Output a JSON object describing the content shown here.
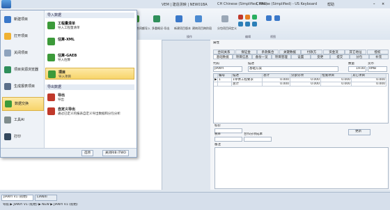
{
  "titlebar": {
    "app_title": "VEM | 建造测映 | NEW01BA",
    "ime1": "CH Chinese (Simplified, PRC)",
    "ime2": "Chinese (Simplified) - US Keyboard",
    "help": "帮助"
  },
  "ribbon": {
    "buttons": [
      "合同额导入",
      "多重概况-导出",
      "新建项目版本",
      "建筑项目跨阶段",
      "分包项目间定义"
    ],
    "groups": [
      "操作",
      "编辑",
      "视图"
    ]
  },
  "menu": {
    "left_items": [
      {
        "label": "新建项目"
      },
      {
        "label": "打开项目"
      },
      {
        "label": "关闭项目"
      },
      {
        "label": "项目资源浏览器"
      },
      {
        "label": "生成报表项目"
      },
      {
        "label": "数据交换"
      },
      {
        "label": "工具AI"
      },
      {
        "label": "打印"
      }
    ],
    "import_header": "导入数据",
    "import_items": [
      {
        "title": "工程量清单",
        "desc": "导入工程量清单"
      },
      {
        "title": "估算-XML",
        "desc": ""
      },
      {
        "title": "估算-GAEB",
        "desc": "导入估算"
      },
      {
        "title": "项目",
        "desc": "导入项目"
      }
    ],
    "export_header": "导出数据",
    "export_items": [
      {
        "title": "导出",
        "desc": "导出"
      },
      {
        "title": "自定义导出",
        "desc": "通过已定义的报表自定义导出数据和分包分析"
      }
    ],
    "footer": {
      "options": "选项",
      "exit": "关闭RIB iTWO"
    }
  },
  "rightpane": {
    "title": "属性",
    "tabs_row1": [
      "合同关系",
      "保证金",
      "条款集合",
      "关键数据",
      "付款方",
      "资金流",
      "其它地址",
      "授权"
    ],
    "tabs_row2": [
      "基础数据",
      "项目信息",
      "备份一览",
      "项目管理",
      "设置",
      "变更",
      "提交",
      "分包",
      "补充"
    ],
    "code_label": "代码",
    "code_value": "JIANYI",
    "desc_label": "描述",
    "desc_value": "基础方案",
    "currency_label": "货币",
    "rate_label": "数量",
    "rate_value": "19.00",
    "currency_value": "RMB",
    "table": {
      "headers": [
        "",
        "编号",
        "描述",
        "总计",
        "分部分项",
        "措施项目",
        "其它项目"
      ],
      "rows": [
        [
          "▶",
          "1",
          "1单体工程要求",
          "0.000",
          "0.000",
          "0.000",
          "0.000"
        ],
        [
          "",
          "",
          "总计",
          "0.000",
          "0.000",
          "0.000",
          "0.000"
        ]
      ]
    },
    "remarks_label": "标价",
    "tax_label": "税率",
    "contract_label": "合作分项成本",
    "update_button": "更新",
    "notes_label": "备注"
  },
  "status": {
    "tab1": "JIANYI V1 (初始)",
    "tab2": "LIANXI",
    "breadcrumb": "导航 ▶ JIANYI V1 (初始) ▶ NEW ▶ JIANYI V1 (初始)"
  },
  "colors": {
    "accent": "#f7d46a",
    "menu_border": "#8da5c4",
    "green_icon": "#3c9a3a",
    "blue_icon": "#3a78c9"
  }
}
